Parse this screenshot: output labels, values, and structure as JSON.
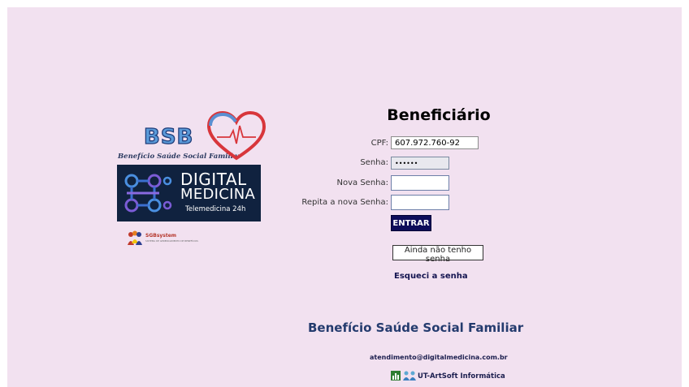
{
  "logos": {
    "bsb": {
      "text": "BSB",
      "subtitle": "Benefício Saúde Social Familiar"
    },
    "digital_medicina": {
      "line1": "DIGITAL",
      "line2": "MEDICINA",
      "tagline": "Telemedicina 24h"
    },
    "sgb": {
      "name": "SGBsystem",
      "subtitle": "SISTEMA DE GERENCIAMENTO DE BENEFÍCIOS"
    }
  },
  "form": {
    "title": "Beneficiário",
    "cpf_label": "CPF:",
    "cpf_value": "607.972.760-92",
    "senha_label": "Senha:",
    "senha_value": "••••••",
    "nova_senha_label": "Nova Senha:",
    "nova_senha_value": "",
    "repita_label": "Repita a nova Senha:",
    "repita_value": "",
    "entrar_label": "ENTRAR",
    "ainda_label": "Ainda não tenho senha",
    "esqueci_label": "Esqueci a senha"
  },
  "footer": {
    "title": "Benefício Saúde Social Familiar",
    "email": "atendimento@digitalmedicina.com.br",
    "vendor": "UT-ArtSoft Informática"
  },
  "colors": {
    "background": "#f2e1f0",
    "button_bg": "#0d0d5a",
    "footer_title": "#243b6e"
  }
}
